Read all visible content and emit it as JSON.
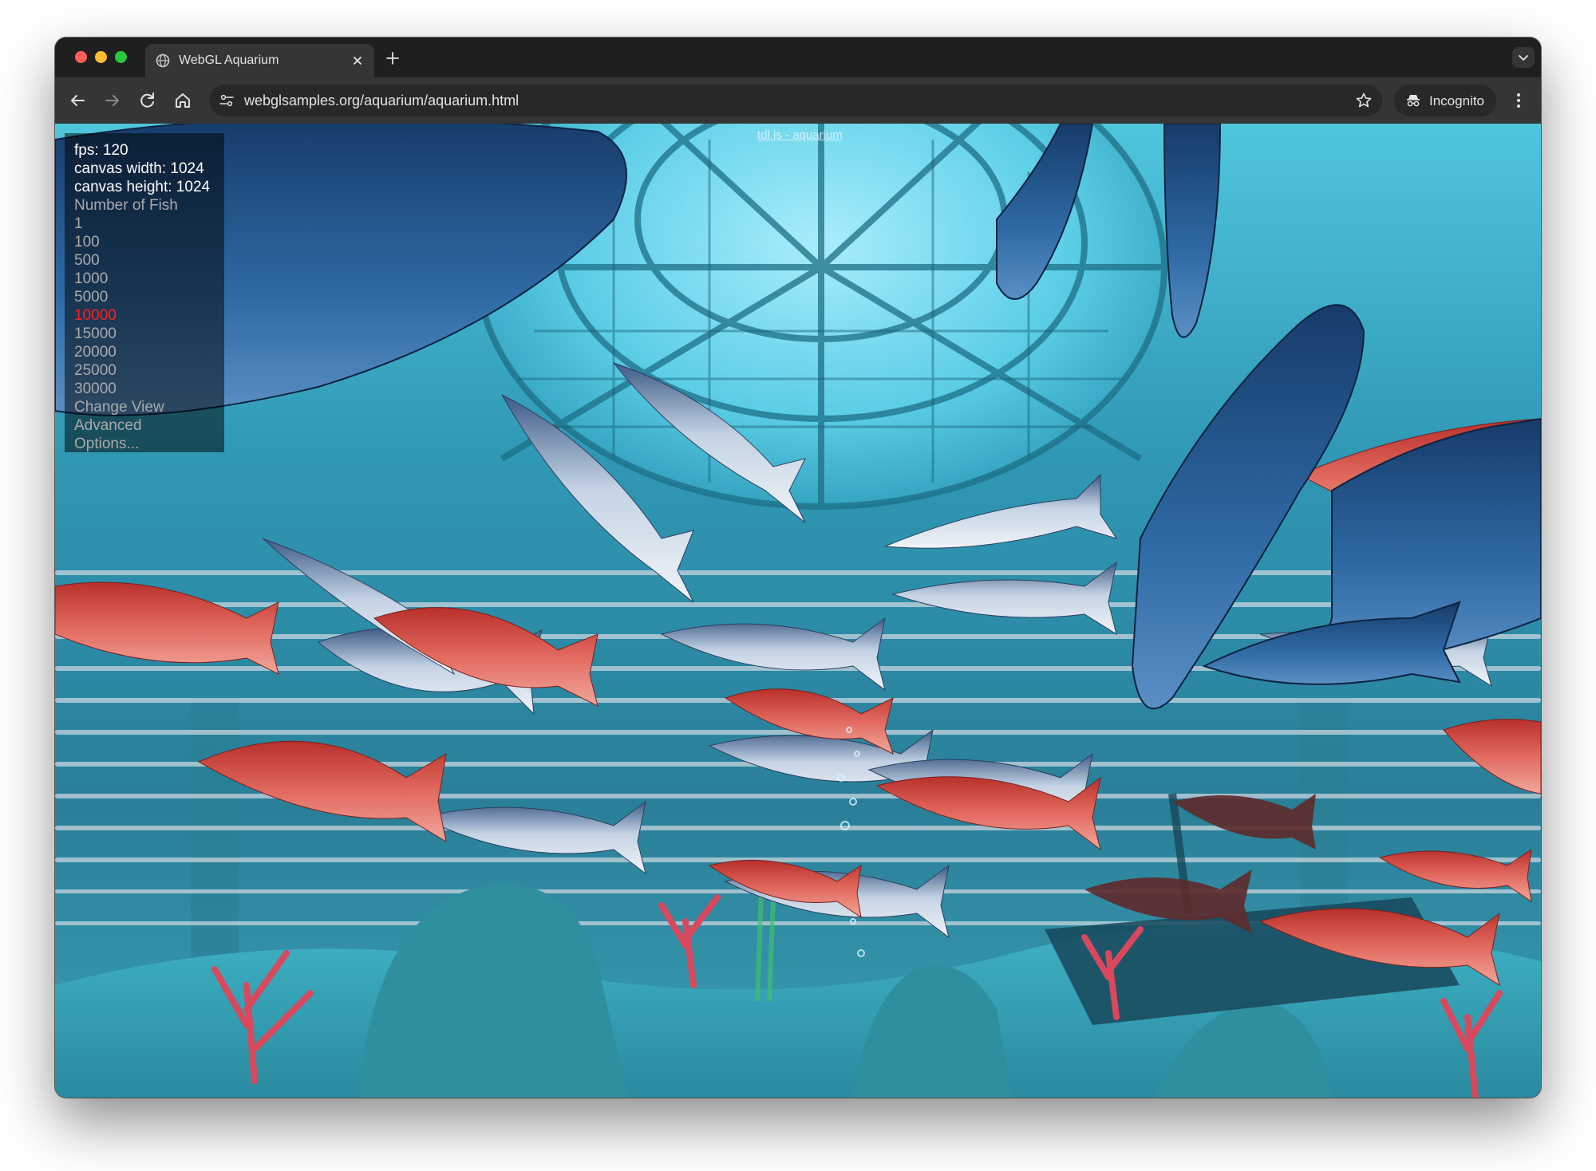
{
  "browser": {
    "tab": {
      "title": "WebGL Aquarium",
      "icon": "globe-icon"
    },
    "url": "webglsamples.org/aquarium/aquarium.html",
    "profile_label": "Incognito"
  },
  "page": {
    "header": {
      "link": "tdl.js",
      "separator": " - ",
      "title": "aquarium"
    },
    "stats": {
      "fps": "fps: 120",
      "canvas_width": "canvas width: 1024",
      "canvas_height": "canvas height: 1024"
    },
    "fish_menu": {
      "heading": "Number of Fish",
      "options": [
        "1",
        "100",
        "500",
        "1000",
        "5000",
        "10000",
        "15000",
        "20000",
        "25000",
        "30000"
      ],
      "selected": "10000"
    },
    "links": {
      "change_view": "Change View",
      "advanced": "Advanced",
      "options": "Options..."
    }
  },
  "colors": {
    "selected_option": "#ff2020",
    "water": "#2b8aa6",
    "red_fish": "#d9483f",
    "silver_fish": "#9db2c8"
  }
}
